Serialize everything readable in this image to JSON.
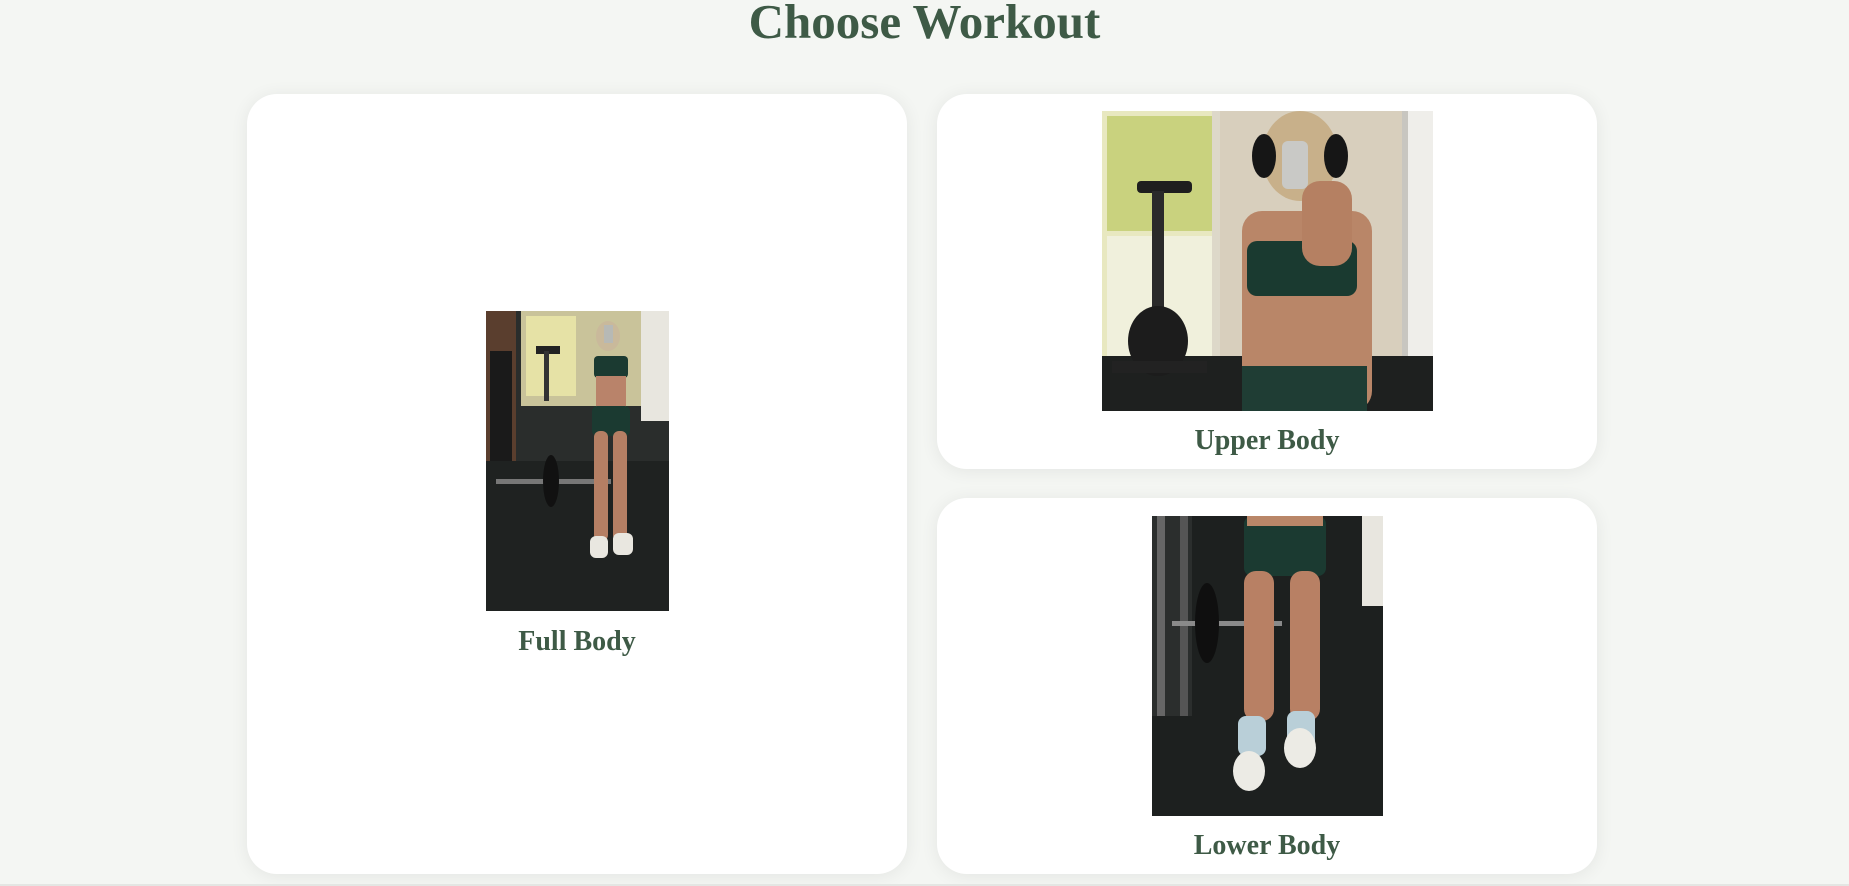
{
  "page": {
    "title": "Choose Workout",
    "colors": {
      "background": "#f4f6f3",
      "card": "#ffffff",
      "accent_text": "#3e5a46"
    }
  },
  "workouts": [
    {
      "label": "Full Body",
      "image": "gym-mirror-selfie-full-length-photo"
    },
    {
      "label": "Upper Body",
      "image": "gym-mirror-selfie-upper-body-photo"
    },
    {
      "label": "Lower Body",
      "image": "gym-legs-photo"
    }
  ]
}
